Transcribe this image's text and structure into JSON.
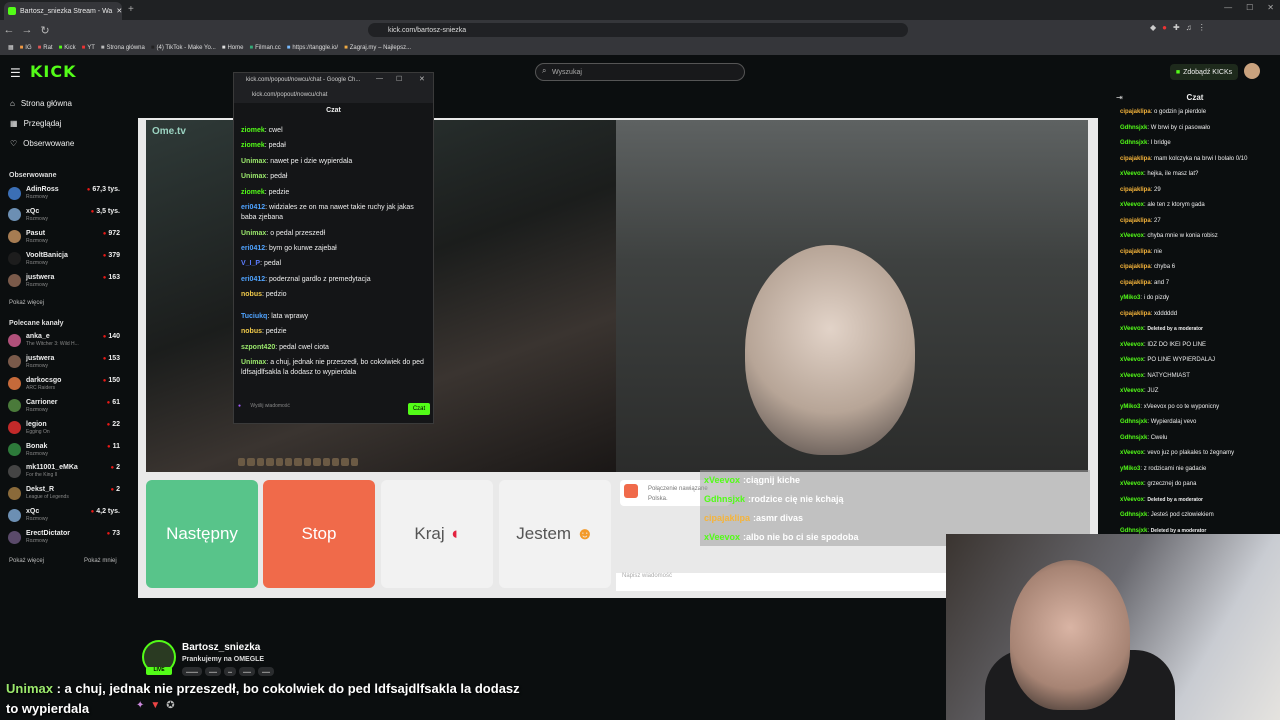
{
  "browser": {
    "tab_title": "Bartosz_sniezka Stream - Wa",
    "url": "kick.com/bartosz-sniezka",
    "bookmarks": [
      "IG",
      "Rat",
      "Kick",
      "YT",
      "Strona główna",
      "(4) TikTok - Make Yo...",
      "Home",
      "Filman.cc",
      "https://tanggle.io/",
      "Zagraj.my – Najlepsz..."
    ]
  },
  "kick": {
    "logo": "KICK",
    "search_placeholder": "Wyszukaj",
    "get_kicks": "Zdobądź KICKs",
    "nav": [
      "Strona główna",
      "Przeglądaj",
      "Obserwowane"
    ],
    "followed_title": "Obserwowane",
    "followed": [
      {
        "name": "AdinRoss",
        "cat": "Rozmowy",
        "viewers": "67,3 tys.",
        "color": "#3b6fb5"
      },
      {
        "name": "xQc",
        "cat": "Rozmowy",
        "viewers": "3,5 tys.",
        "color": "#6c8fb3"
      },
      {
        "name": "Pasut",
        "cat": "Rozmowy",
        "viewers": "972",
        "color": "#a67c52"
      },
      {
        "name": "VooltBanicja",
        "cat": "Rozmowy",
        "viewers": "379",
        "color": "#1d1d1d"
      },
      {
        "name": "justwera",
        "cat": "Rozmowy",
        "viewers": "163",
        "color": "#7a5a4a"
      }
    ],
    "show_more_1": "Pokaż więcej",
    "recommended_title": "Polecane kanały",
    "recommended": [
      {
        "name": "anka_e",
        "cat": "The Witcher 3: Wild H...",
        "viewers": "140",
        "color": "#b0507a"
      },
      {
        "name": "justwera",
        "cat": "Rozmowy",
        "viewers": "153",
        "color": "#7a5a4a"
      },
      {
        "name": "darkocsgo",
        "cat": "ARC Raiders",
        "viewers": "150",
        "color": "#c66a3a"
      },
      {
        "name": "Carrioner",
        "cat": "Rozmowy",
        "viewers": "61",
        "color": "#4a7a3a"
      },
      {
        "name": "legion",
        "cat": "Egging On",
        "viewers": "22",
        "color": "#c22a2a"
      },
      {
        "name": "Bonak",
        "cat": "Rozmowy",
        "viewers": "11",
        "color": "#2d7a3a"
      },
      {
        "name": "mk11001_eMKa",
        "cat": "For the King II",
        "viewers": "2",
        "color": "#444"
      },
      {
        "name": "Dekst_R",
        "cat": "League of Legends",
        "viewers": "2",
        "color": "#8a6a3a"
      },
      {
        "name": "xQc",
        "cat": "Rozmowy",
        "viewers": "4,2 tys.",
        "color": "#6c8fb3"
      },
      {
        "name": "ErectDictator",
        "cat": "Rozmowy",
        "viewers": "73",
        "color": "#5a4a6a"
      }
    ],
    "show_more_2": "Pokaż więcej",
    "show_less": "Pokaż mniej"
  },
  "popup": {
    "title": "kick.com/popout/nowcu/chat - Google Ch...",
    "url": "kick.com/popout/nowcu/chat",
    "header": "Czat",
    "messages": [
      {
        "u": "ziomek",
        "t": "cwel",
        "c": "#53fc18"
      },
      {
        "u": "ziomek",
        "t": "pedał",
        "c": "#53fc18"
      },
      {
        "u": "Unimax",
        "t": "nawet pe i dzie wypierdala",
        "c": "#9be86c"
      },
      {
        "u": "Unimax",
        "t": "pedał",
        "c": "#9be86c"
      },
      {
        "u": "ziomek",
        "t": "pedzie",
        "c": "#53fc18"
      },
      {
        "u": "eri0412",
        "t": "widziales ze on ma nawet takie ruchy jak jakas baba zjebana",
        "c": "#4fa3ff"
      },
      {
        "u": "Unimax",
        "t": "o pedal przeszedł",
        "c": "#9be86c"
      },
      {
        "u": "eri0412",
        "t": "bym go kurwe zajebał",
        "c": "#4fa3ff"
      },
      {
        "u": "V_I_P",
        "t": "pedal",
        "c": "#5b7cff"
      },
      {
        "u": "eri0412",
        "t": "poderznal gardlo z premedytacja",
        "c": "#4fa3ff"
      },
      {
        "u": "nobus",
        "t": "pedzio",
        "c": "#f0c94a"
      },
      {
        "u": "Tuciukq",
        "t": "lata wprawy",
        "c": "#4fa3ff"
      },
      {
        "u": "nobus",
        "t": "pedzie",
        "c": "#f0c94a"
      },
      {
        "u": "szpont420",
        "t": "pedal cwel ciota",
        "c": "#9be86c"
      },
      {
        "u": "Unimax",
        "t": "a chuj, jednak nie przeszedł, bo cokolwiek do ped ldfsajdlfsakla la dodasz to wypierdala",
        "c": "#9be86c"
      }
    ],
    "input_placeholder": "Wyślij wiadomość",
    "send": "Czat"
  },
  "omegle": {
    "logo": "Ome.tv",
    "next": "Następny",
    "stop": "Stop",
    "country": "Kraj",
    "me": "Jestem",
    "notice_1": "Połączenie nawiązane",
    "notice_2": "Polska.",
    "input_placeholder": "Napisz wiadomość",
    "overlay": [
      {
        "u": "xVeevox",
        "t": "ciągnij kiche",
        "c": "#53fc18"
      },
      {
        "u": "Gdhnsjxk",
        "t": "rodzice cię nie kchają",
        "c": "#53fc18"
      },
      {
        "u": "cipajaklipa",
        "t": "asmr divas",
        "c": "#f5b43a"
      },
      {
        "u": "xVeevox",
        "t": "albo nie bo ci sie spodoba",
        "c": "#53fc18"
      }
    ]
  },
  "right_chat": {
    "title": "Czat",
    "messages": [
      {
        "u": "cipajaklipa",
        "t": "o godzin ja pierdole",
        "c": "#f5b43a"
      },
      {
        "u": "Gdhnsjxk",
        "t": "W brwi by ci pasowało",
        "c": "#53fc18"
      },
      {
        "u": "Gdhnsjxk",
        "t": "I bridge",
        "c": "#53fc18"
      },
      {
        "u": "cipajaklipa",
        "t": "mam kolczyka na brwi I bolało 0/10",
        "c": "#f5b43a"
      },
      {
        "u": "xVeevox",
        "t": "hejka, ile masz lat?",
        "c": "#53fc18"
      },
      {
        "u": "cipajaklipa",
        "t": "29",
        "c": "#f5b43a"
      },
      {
        "u": "xVeevox",
        "t": "ale ten z ktorym gada",
        "c": "#53fc18"
      },
      {
        "u": "cipajaklipa",
        "t": "27",
        "c": "#f5b43a"
      },
      {
        "u": "xVeevox",
        "t": "chyba mnie w konia robisz",
        "c": "#53fc18"
      },
      {
        "u": "cipajaklipa",
        "t": "nie",
        "c": "#f5b43a"
      },
      {
        "u": "cipajaklipa",
        "t": "chyba 6",
        "c": "#f5b43a"
      },
      {
        "u": "cipajaklipa",
        "t": "and 7",
        "c": "#f5b43a"
      },
      {
        "u": "yMiko3",
        "t": "i do pizdy",
        "c": "#53fc18"
      },
      {
        "u": "cipajaklipa",
        "t": "xdddddd",
        "c": "#f5b43a"
      },
      {
        "u": "xVeevox",
        "t": "Deleted by a moderator",
        "c": "#53fc18"
      },
      {
        "u": "xVeevox",
        "t": "IDZ DO IKEI PO LINE",
        "c": "#53fc18"
      },
      {
        "u": "xVeevox",
        "t": "PO LINE WYPIERDALAJ",
        "c": "#53fc18"
      },
      {
        "u": "xVeevox",
        "t": "NATYCHMIAST",
        "c": "#53fc18"
      },
      {
        "u": "xVeevox",
        "t": "JUZ",
        "c": "#53fc18"
      },
      {
        "u": "yMiko3",
        "t": "xVeevox po co te wyponicny",
        "c": "#53fc18"
      },
      {
        "u": "Gdhnsjxk",
        "t": "Wypierdalaj vevo",
        "c": "#53fc18"
      },
      {
        "u": "Gdhnsjxk",
        "t": "Cwelu",
        "c": "#53fc18"
      },
      {
        "u": "xVeevox",
        "t": "vevo juz po plakales to żegnamy",
        "c": "#53fc18"
      },
      {
        "u": "yMiko3",
        "t": "z rodzicami nie gadacie",
        "c": "#53fc18"
      },
      {
        "u": "xVeevox",
        "t": "grzecznej do pana",
        "c": "#53fc18"
      },
      {
        "u": "xVeevox",
        "t": "Deleted by a moderator",
        "c": "#53fc18"
      },
      {
        "u": "Gdhnsjxk",
        "t": "Jesteś pod człowiekiem",
        "c": "#53fc18"
      },
      {
        "u": "Gdhnsjxk",
        "t": "Deleted by a moderator",
        "c": "#53fc18"
      }
    ]
  },
  "streamer": {
    "name": "Bartosz_sniezka",
    "title": "Prankujemy na OMEGLE",
    "live": "LIVE",
    "big_user": "Unimax",
    "big_text": "a chuj, jednak nie przeszedł, bo cokolwiek do ped ldfsajdlfsakla la dodasz to wypierdala"
  }
}
